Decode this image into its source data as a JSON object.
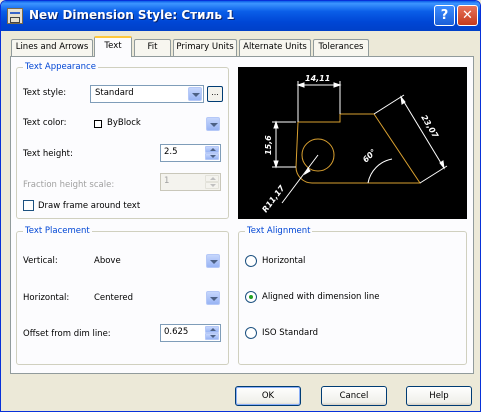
{
  "window": {
    "title": "New Dimension Style: Стиль 1",
    "help_button": "?",
    "close_button": "✕"
  },
  "tabs": [
    {
      "label": "Lines and Arrows"
    },
    {
      "label": "Text",
      "active": true
    },
    {
      "label": "Fit"
    },
    {
      "label": "Primary Units"
    },
    {
      "label": "Alternate Units"
    },
    {
      "label": "Tolerances"
    }
  ],
  "text_appearance": {
    "legend": "Text Appearance",
    "text_style_label": "Text style:",
    "text_style_value": "Standard",
    "ellipsis_label": "...",
    "text_color_label": "Text color:",
    "text_color_value": "ByBlock",
    "text_height_label": "Text height:",
    "text_height_value": "2.5",
    "fraction_height_label": "Fraction height scale:",
    "fraction_height_value": "1",
    "draw_frame_label": "Draw frame around text",
    "draw_frame_checked": false
  },
  "preview": {
    "dim_top": "14,11",
    "dim_left": "15,6",
    "dim_right": "23,07",
    "dim_angle": "60°",
    "dim_radius": "R11,17"
  },
  "text_placement": {
    "legend": "Text Placement",
    "vertical_label": "Vertical:",
    "vertical_value": "Above",
    "horizontal_label": "Horizontal:",
    "horizontal_value": "Centered",
    "offset_label": "Offset from dim line:",
    "offset_value": "0.625"
  },
  "text_alignment": {
    "legend": "Text Alignment",
    "options": [
      {
        "label": "Horizontal",
        "checked": false
      },
      {
        "label": "Aligned with dimension line",
        "checked": true
      },
      {
        "label": "ISO Standard",
        "checked": false
      }
    ]
  },
  "buttons": {
    "ok": "OK",
    "cancel": "Cancel",
    "help": "Help"
  },
  "colors": {
    "title_bar": "#0a5ee8",
    "group_legend": "#0046d5",
    "preview_background": "#000000",
    "preview_shape": "#d9a030",
    "preview_dimensions": "#ffffff"
  }
}
